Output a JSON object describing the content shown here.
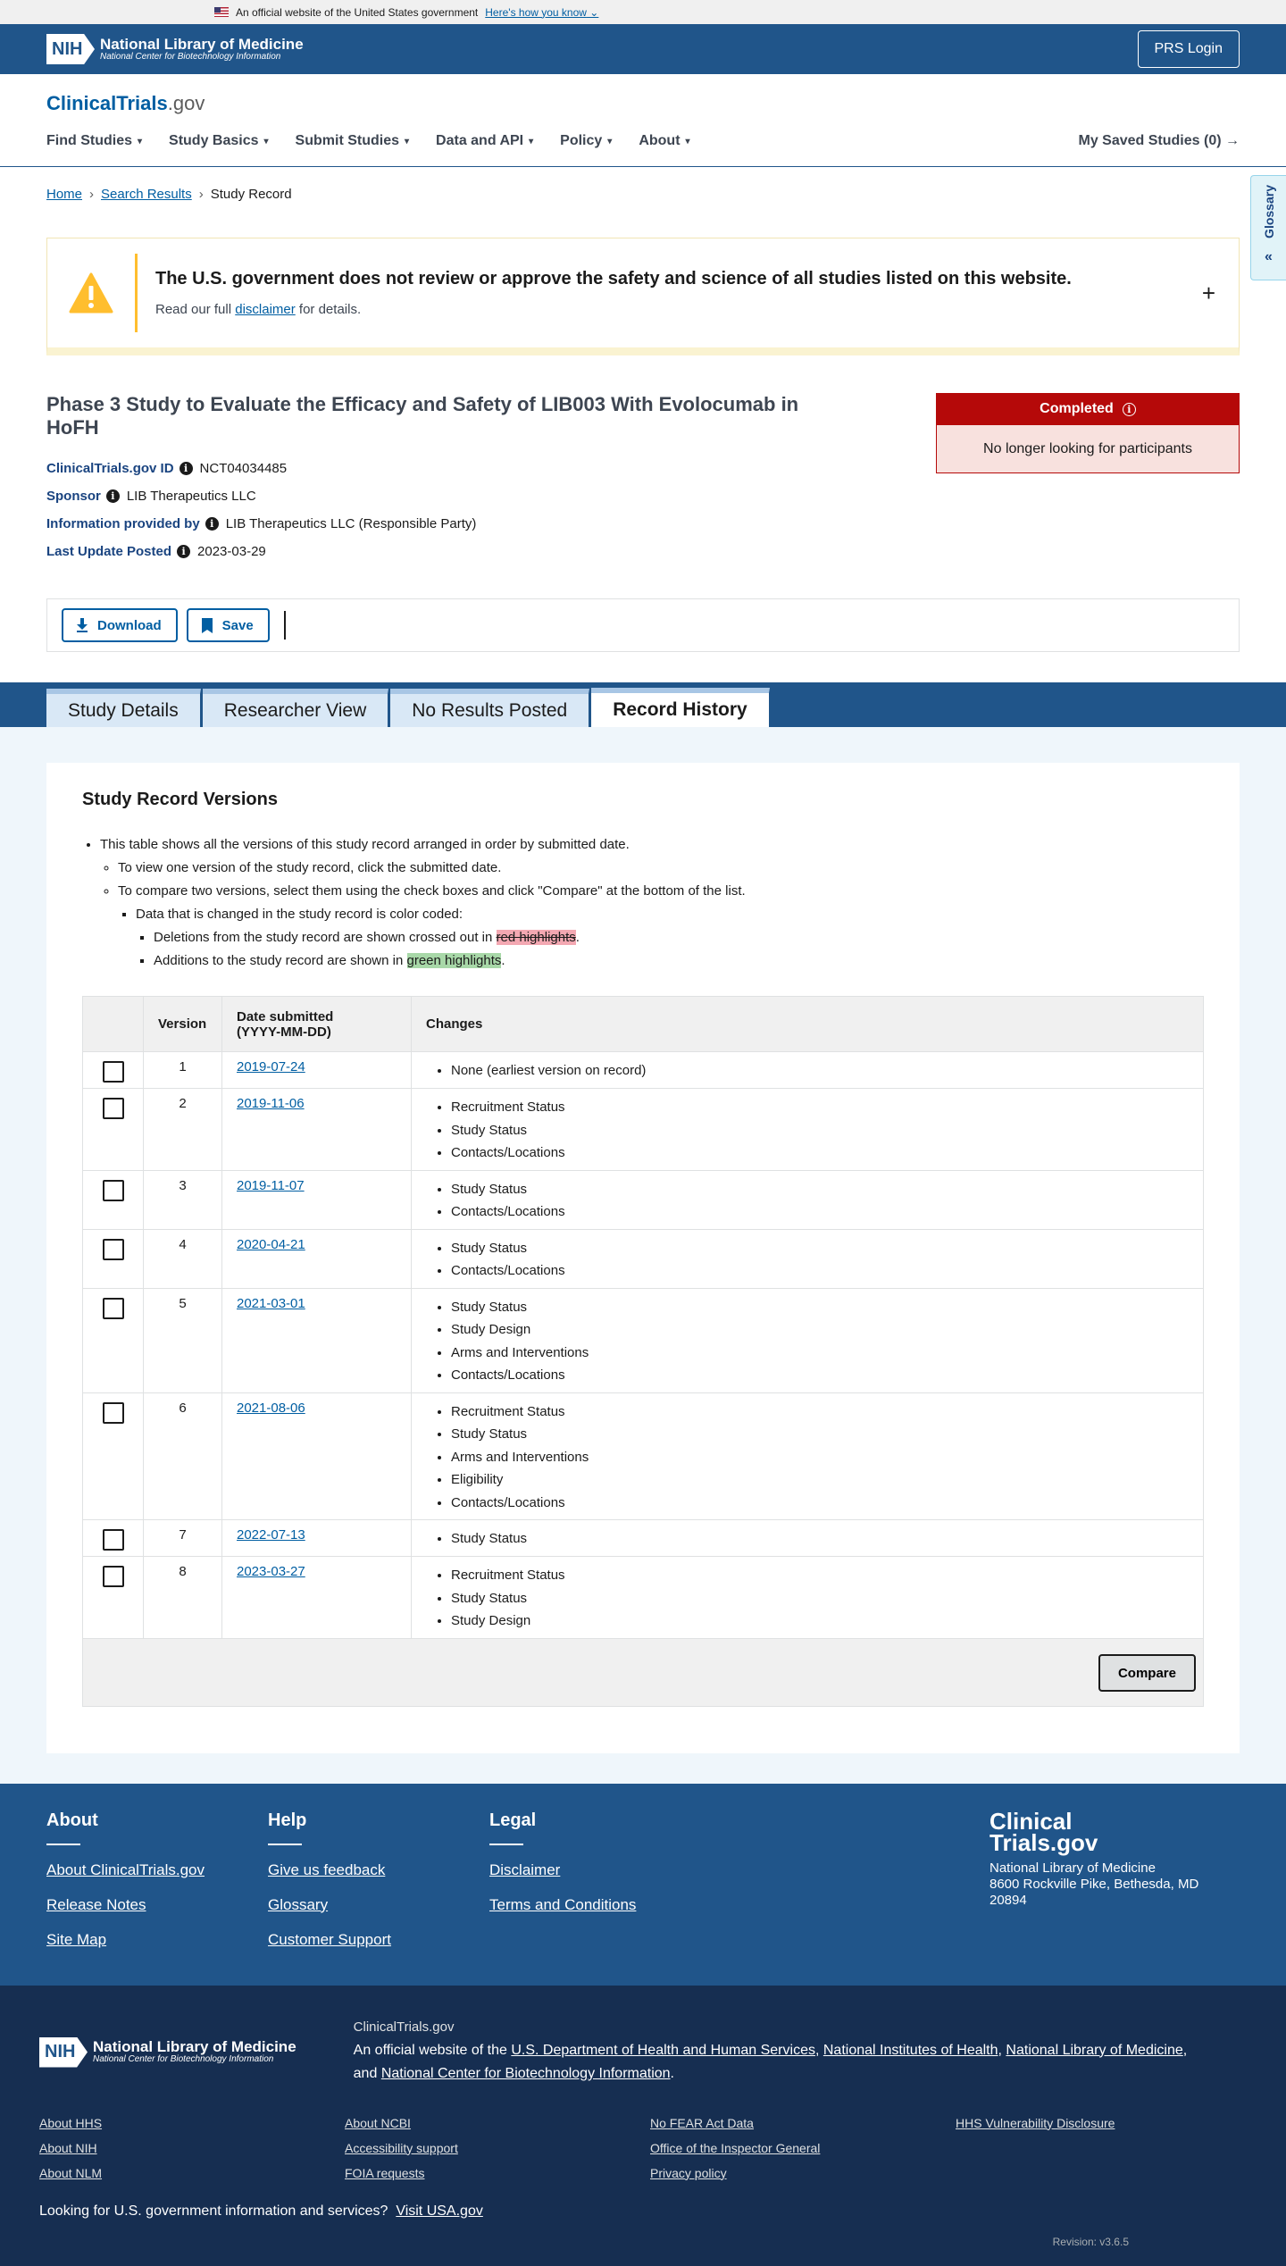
{
  "gov_banner": {
    "text": "An official website of the United States government",
    "link": "Here's how you know"
  },
  "nih_header": {
    "logo_badge": "NIH",
    "logo_title": "National Library of Medicine",
    "logo_subtitle": "National Center for Biotechnology Information",
    "login_button": "PRS Login"
  },
  "site": {
    "logo_main": "ClinicalTrials",
    "logo_suffix": ".gov"
  },
  "nav": {
    "items": [
      "Find Studies",
      "Study Basics",
      "Submit Studies",
      "Data and API",
      "Policy",
      "About"
    ],
    "saved": "My Saved Studies (0)"
  },
  "glossary": {
    "label": "Glossary"
  },
  "breadcrumb": {
    "home": "Home",
    "search": "Search Results",
    "current": "Study Record"
  },
  "alert": {
    "heading": "The U.S. government does not review or approve the safety and science of all studies listed on this website.",
    "pre": "Read our full",
    "link": "disclaimer",
    "post": "for details."
  },
  "study": {
    "title": "Phase 3 Study to Evaluate the Efficacy and Safety of LIB003 With Evolocumab in HoFH",
    "id_label": "ClinicalTrials.gov ID",
    "id": "NCT04034485",
    "sponsor_label": "Sponsor",
    "sponsor": "LIB Therapeutics LLC",
    "provided_label": "Information provided by",
    "provided": "LIB Therapeutics LLC (Responsible Party)",
    "update_label": "Last Update Posted",
    "update": "2023-03-29",
    "status": "Completed",
    "status_note": "No longer looking for participants"
  },
  "toolbar": {
    "download": "Download",
    "save": "Save"
  },
  "tabs": [
    "Study Details",
    "Researcher View",
    "No Results Posted",
    "Record History"
  ],
  "versions": {
    "heading": "Study Record Versions",
    "note1": "This table shows all the versions of this study record arranged in order by submitted date.",
    "note2": "To view one version of the study record, click the submitted date.",
    "note3": "To compare two versions, select them using the check boxes and click \"Compare\" at the bottom of the list.",
    "note4": "Data that is changed in the study record is color coded:",
    "note5_pre": "Deletions from the study record are shown crossed out in",
    "note5_hl": "red highlights",
    "note6_pre": "Additions to the study record are shown in",
    "note6_hl": "green highlights",
    "col_version": "Version",
    "col_date_1": "Date submitted",
    "col_date_2": "(YYYY-MM-DD)",
    "col_changes": "Changes",
    "compare": "Compare",
    "rows": [
      {
        "version": "1",
        "date": "2019-07-24",
        "changes": [
          "None (earliest version on record)"
        ]
      },
      {
        "version": "2",
        "date": "2019-11-06",
        "changes": [
          "Recruitment Status",
          "Study Status",
          "Contacts/Locations"
        ]
      },
      {
        "version": "3",
        "date": "2019-11-07",
        "changes": [
          "Study Status",
          "Contacts/Locations"
        ]
      },
      {
        "version": "4",
        "date": "2020-04-21",
        "changes": [
          "Study Status",
          "Contacts/Locations"
        ]
      },
      {
        "version": "5",
        "date": "2021-03-01",
        "changes": [
          "Study Status",
          "Study Design",
          "Arms and Interventions",
          "Contacts/Locations"
        ]
      },
      {
        "version": "6",
        "date": "2021-08-06",
        "changes": [
          "Recruitment Status",
          "Study Status",
          "Arms and Interventions",
          "Eligibility",
          "Contacts/Locations"
        ]
      },
      {
        "version": "7",
        "date": "2022-07-13",
        "changes": [
          "Study Status"
        ]
      },
      {
        "version": "8",
        "date": "2023-03-27",
        "changes": [
          "Recruitment Status",
          "Study Status",
          "Study Design"
        ]
      }
    ]
  },
  "footer": {
    "about": {
      "title": "About",
      "links": [
        "About ClinicalTrials.gov",
        "Release Notes",
        "Site Map"
      ]
    },
    "help": {
      "title": "Help",
      "links": [
        "Give us feedback",
        "Glossary",
        "Customer Support"
      ]
    },
    "legal": {
      "title": "Legal",
      "links": [
        "Disclaimer",
        "Terms and Conditions"
      ]
    },
    "address": {
      "logo_1": "Clinical",
      "logo_2": "Trials.gov",
      "line1": "National Library of Medicine",
      "line2": "8600 Rockville Pike, Bethesda, MD",
      "line3": "20894"
    },
    "site_label": "ClinicalTrials.gov",
    "official_pre": "An official website of the",
    "hhs": "U.S. Department of Health and Human Services",
    "nih": "National Institutes of Health",
    "nlm": "National Library of Medicine",
    "and": "and",
    "ncbi": "National Center for Biotechnology Information",
    "links": [
      "About HHS",
      "About NCBI",
      "No FEAR Act Data",
      "HHS Vulnerability Disclosure",
      "About NIH",
      "Accessibility support",
      "Office of the Inspector General",
      "",
      "About NLM",
      "FOIA requests",
      "Privacy policy",
      ""
    ],
    "usa_pre": "Looking for U.S. government information and services?",
    "usa_link": "Visit USA.gov",
    "revision": "Revision: v3.6.5"
  }
}
